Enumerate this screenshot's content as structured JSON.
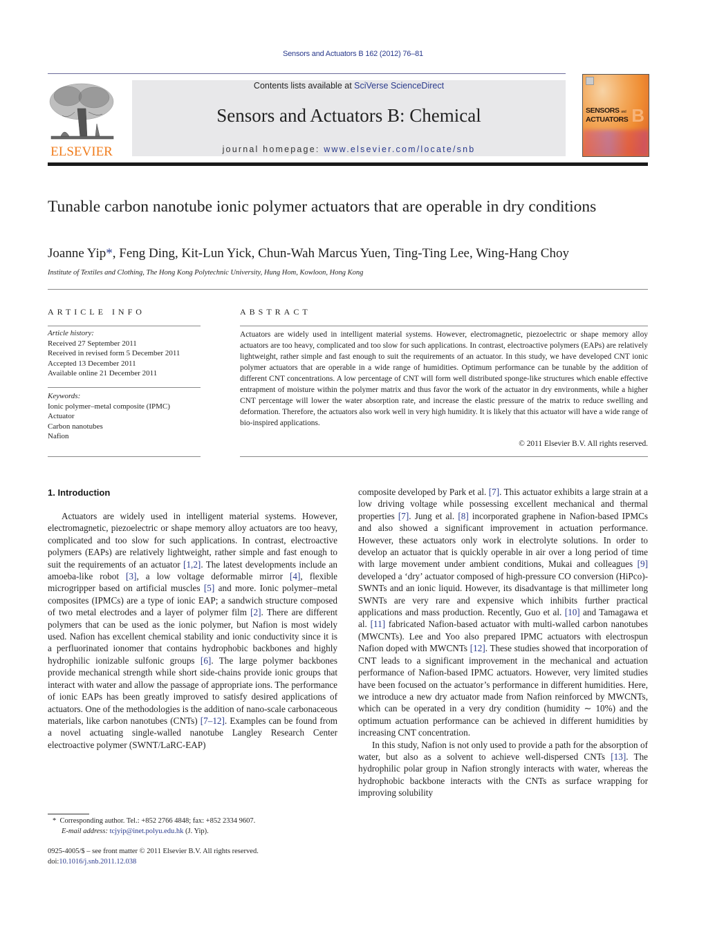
{
  "header": {
    "running_citation": "Sensors and Actuators B 162 (2012) 76–81",
    "contents_prefix": "Contents lists available at ",
    "contents_link": "SciVerse ScienceDirect",
    "journal_title": "Sensors and Actuators B: Chemical",
    "homepage_prefix": "journal homepage: ",
    "homepage_link": "www.elsevier.com/locate/snb",
    "publisher_logo_text": "ELSEVIER",
    "cover_line1": "SENSORS",
    "cover_and": "and",
    "cover_line2": "ACTUATORS",
    "cover_letter": "B",
    "colors": {
      "link": "#2a3a8c",
      "elsevier_orange": "#f07c1c",
      "banner_bg": "#e8e8ea"
    }
  },
  "article": {
    "title": "Tunable carbon nanotube ionic polymer actuators that are operable in dry conditions",
    "authors": "Joanne Yip",
    "author_star": "*",
    "authors_rest": ", Feng Ding, Kit-Lun Yick, Chun-Wah Marcus Yuen, Ting-Ting Lee, Wing-Hang Choy",
    "affiliation": "Institute of Textiles and Clothing, The Hong Kong Polytechnic University, Hung Hom, Kowloon, Hong Kong"
  },
  "article_info": {
    "heading": "ARTICLE INFO",
    "history_label": "Article history:",
    "history": [
      "Received 27 September 2011",
      "Received in revised form 5 December 2011",
      "Accepted 13 December 2011",
      "Available online 21 December 2011"
    ],
    "keywords_label": "Keywords:",
    "keywords": [
      "Ionic polymer–metal composite (IPMC)",
      "Actuator",
      "Carbon nanotubes",
      "Nafion"
    ]
  },
  "abstract": {
    "heading": "ABSTRACT",
    "text": "Actuators are widely used in intelligent material systems. However, electromagnetic, piezoelectric or shape memory alloy actuators are too heavy, complicated and too slow for such applications. In contrast, electroactive polymers (EAPs) are relatively lightweight, rather simple and fast enough to suit the requirements of an actuator. In this study, we have developed CNT ionic polymer actuators that are operable in a wide range of humidities. Optimum performance can be tunable by the addition of different CNT concentrations. A low percentage of CNT will form well distributed sponge-like structures which enable effective entrapment of moisture within the polymer matrix and thus favor the work of the actuator in dry environments, while a higher CNT percentage will lower the water absorption rate, and increase the elastic pressure of the matrix to reduce swelling and deformation. Therefore, the actuators also work well in very high humidity. It is likely that this actuator will have a wide range of bio-inspired applications.",
    "copyright": "© 2011 Elsevier B.V. All rights reserved."
  },
  "introduction": {
    "heading": "1.  Introduction",
    "left_col": [
      {
        "t": "Actuators are widely used in intelligent material systems. However, electromagnetic, piezoelectric or shape memory alloy actuators are too heavy, complicated and too slow for such applications. In contrast, electroactive polymers (EAPs) are relatively lightweight, rather simple and fast enough to suit the requirements of an actuator "
      },
      {
        "ref": "[1,2]"
      },
      {
        "t": ". The latest developments include an amoeba-like robot "
      },
      {
        "ref": "[3]"
      },
      {
        "t": ", a low voltage deformable mirror "
      },
      {
        "ref": "[4]"
      },
      {
        "t": ", flexible microgripper based on artificial muscles "
      },
      {
        "ref": "[5]"
      },
      {
        "t": " and more. Ionic polymer–metal composites (IPMCs) are a type of ionic EAP; a sandwich structure composed of two metal electrodes and a layer of polymer film "
      },
      {
        "ref": "[2]"
      },
      {
        "t": ". There are different polymers that can be used as the ionic polymer, but Nafion is most widely used. Nafion has excellent chemical stability and ionic conductivity since it is a perfluorinated ionomer that contains hydrophobic backbones and highly hydrophilic ionizable sulfonic groups "
      },
      {
        "ref": "[6]"
      },
      {
        "t": ". The large polymer backbones provide mechanical strength while short side-chains provide ionic groups that interact with water and allow the passage of appropriate ions. The performance of ionic EAPs has been greatly improved to satisfy desired applications of actuators. One of the methodologies is the addition of nano-scale carbonaceous materials, like carbon nanotubes (CNTs) "
      },
      {
        "ref": "[7–12]"
      },
      {
        "t": ". Examples can be found from a novel actuating single-walled nanotube Langley Research Center electroactive polymer (SWNT/LaRC-EAP)"
      }
    ],
    "right_col_p1": [
      {
        "t": "composite developed by Park et al. "
      },
      {
        "ref": "[7]"
      },
      {
        "t": ". This actuator exhibits a large strain at a low driving voltage while possessing excellent mechanical and thermal properties "
      },
      {
        "ref": "[7]"
      },
      {
        "t": ". Jung et al. "
      },
      {
        "ref": "[8]"
      },
      {
        "t": " incorporated graphene in Nafion-based IPMCs and also showed a significant improvement in actuation performance. However, these actuators only work in electrolyte solutions. In order to develop an actuator that is quickly operable in air over a long period of time with large movement under ambient conditions, Mukai and colleagues "
      },
      {
        "ref": "[9]"
      },
      {
        "t": " developed a ‘dry’ actuator composed of high-pressure CO conversion (HiPco)-SWNTs and an ionic liquid. However, its disadvantage is that millimeter long SWNTs are very rare and expensive which inhibits further practical applications and mass production. Recently, Guo et al. "
      },
      {
        "ref": "[10]"
      },
      {
        "t": " and Tamagawa et al. "
      },
      {
        "ref": "[11]"
      },
      {
        "t": " fabricated Nafion-based actuator with multi-walled carbon nanotubes (MWCNTs). Lee and Yoo also prepared IPMC actuators with electrospun Nafion doped with MWCNTs "
      },
      {
        "ref": "[12]"
      },
      {
        "t": ". These studies showed that incorporation of CNT leads to a significant improvement in the mechanical and actuation performance of Nafion-based IPMC actuators. However, very limited studies have been focused on the actuator’s performance in different humidities. Here, we introduce a new dry actuator made from Nafion reinforced by MWCNTs, which can be operated in a very dry condition (humidity ∼ 10%) and the optimum actuation performance can be achieved in different humidities by increasing CNT concentration."
      }
    ],
    "right_col_p2": [
      {
        "t": "In this study, Nafion is not only used to provide a path for the absorption of water, but also as a solvent to achieve well-dispersed CNTs "
      },
      {
        "ref": "[13]"
      },
      {
        "t": ". The hydrophilic polar group in Nafion strongly interacts with water, whereas the hydrophobic backbone interacts with the CNTs as surface wrapping for improving solubility"
      }
    ]
  },
  "footnotes": {
    "star": "*",
    "corresponding": "Corresponding author. Tel.: +852 2766 4848; fax: +852 2334 9607.",
    "email_label": "E-mail address:",
    "email": "tcjyip@inet.polyu.edu.hk",
    "email_suffix": " (J. Yip).",
    "issn_line": "0925-4005/$ – see front matter © 2011 Elsevier B.V. All rights reserved.",
    "doi_prefix": "doi:",
    "doi": "10.1016/j.snb.2011.12.038"
  }
}
